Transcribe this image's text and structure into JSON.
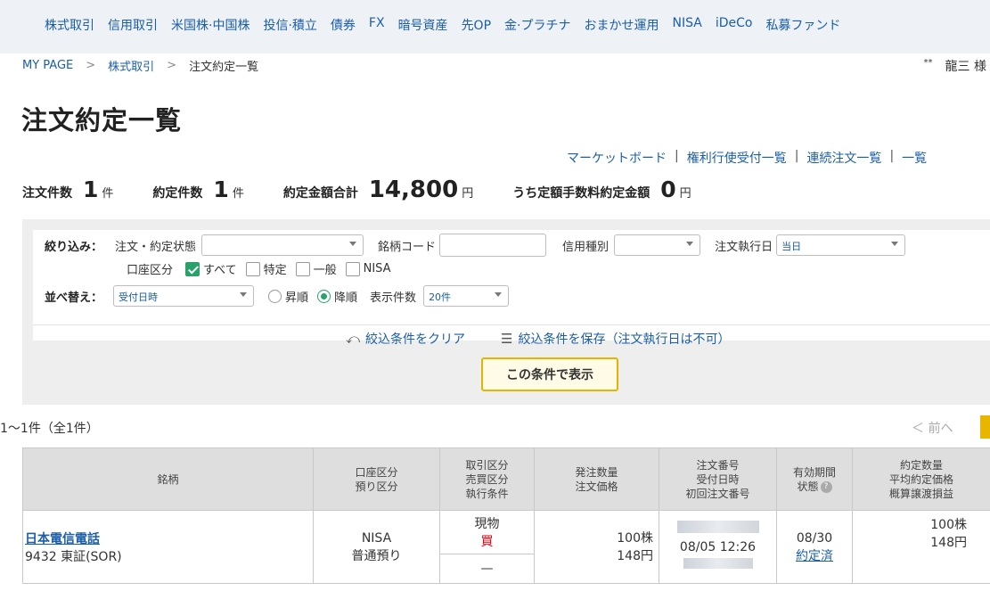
{
  "nav": {
    "items": [
      "株式取引",
      "信用取引",
      "米国株·中国株",
      "投信·積立",
      "債券",
      "FX",
      "暗号資産",
      "先OP",
      "金·プラチナ",
      "おまかせ運用",
      "NISA",
      "iDeCo",
      "私募ファンド"
    ]
  },
  "breadcrumb": {
    "home": "MY PAGE",
    "sep": ">",
    "parent": "株式取引",
    "current": "注文約定一覧"
  },
  "user": {
    "stars": "**",
    "name": "龍三 様"
  },
  "page": {
    "title": "注文約定一覧"
  },
  "sublinks": {
    "items": [
      "マーケットボード",
      "権利行使受付一覧",
      "連続注文一覧",
      "一覧"
    ],
    "sep": "|"
  },
  "summary": {
    "order_count_label": "注文件数",
    "order_count": "1",
    "count_unit": "件",
    "exec_count_label": "約定件数",
    "exec_count": "1",
    "total_label": "約定金額合計",
    "total": "14,800",
    "yen": "円",
    "fee_label": "うち定額手数料約定金額",
    "fee": "0"
  },
  "filter": {
    "narrow_label": "絞り込み：",
    "status_label": "注文・約定状態",
    "status_value": "",
    "code_label": "銘柄コード",
    "code_value": "",
    "credit_label": "信用種別",
    "credit_value": "",
    "exec_date_label": "注文執行日",
    "exec_date_value": "当日",
    "account_label": "口座区分",
    "accounts": [
      {
        "label": "すべて",
        "checked": true
      },
      {
        "label": "特定",
        "checked": false
      },
      {
        "label": "一般",
        "checked": false
      },
      {
        "label": "NISA",
        "checked": false
      }
    ],
    "sort_label": "並べ替え：",
    "sort_value": "受付日時",
    "asc_label": "昇順",
    "desc_label": "降順",
    "display_count_label": "表示件数",
    "display_count_value": "20件",
    "clear_label": "絞込条件をクリア",
    "save_label": "絞込条件を保存（注文執行日は不可）",
    "show_button": "この条件で表示"
  },
  "results": {
    "count_text": "1〜1件（全1件）",
    "prev_label": "＜ 前へ"
  },
  "table": {
    "headers": {
      "stock": "銘柄",
      "account": [
        "口座区分",
        "預り区分"
      ],
      "trade": [
        "取引区分",
        "売買区分",
        "執行条件"
      ],
      "order_qty": [
        "発注数量",
        "注文価格"
      ],
      "order_no": [
        "注文番号",
        "受付日時",
        "初回注文番号"
      ],
      "validity": [
        "有効期間",
        "状態"
      ],
      "exec": [
        "約定数量",
        "平均約定価格",
        "概算譲渡損益"
      ]
    },
    "rows": [
      {
        "name": "日本電信電話",
        "code": "9432 東証(SOR)",
        "account": "NISA",
        "deposit": "普通預り",
        "trade_type": "現物",
        "side": "買",
        "condition": "—",
        "order_qty": "100株",
        "order_price": "148円",
        "received": "08/05 12:26",
        "validity": "08/30",
        "status": "約定済",
        "exec_qty": "100株",
        "exec_price": "148円"
      }
    ]
  },
  "colors": {
    "link": "#1a5ea8",
    "accent_green": "#29a16a",
    "button_border": "#e4b400",
    "sell_buy_red": "#e60012"
  }
}
